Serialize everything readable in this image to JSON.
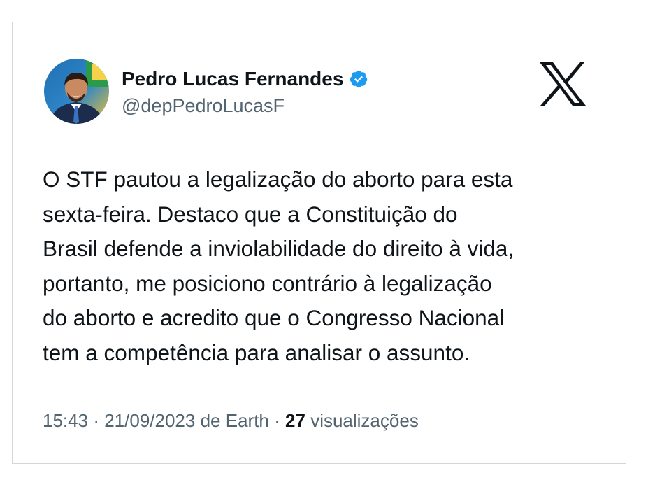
{
  "author": {
    "display_name": "Pedro Lucas Fernandes",
    "handle": "@depPedroLucasF",
    "verified": true
  },
  "tweet": {
    "lines": [
      "O STF pautou a legalização do aborto para esta",
      "sexta-feira. Destaco que a Constituição do",
      "Brasil defende a inviolabilidade do direito à vida,",
      "portanto, me posiciono contrário à legalização",
      "do aborto e acredito que o Congresso Nacional",
      "tem a competência para analisar o assunto."
    ]
  },
  "meta": {
    "time": "15:43",
    "separator": "·",
    "date": "21/09/2023",
    "source": "de Earth",
    "views_count": "27",
    "views_label": "visualizações"
  },
  "icons": {
    "logo": "x-logo-icon",
    "verified": "verified-badge-icon"
  },
  "colors": {
    "verified_blue": "#1d9bf0",
    "secondary_text": "#536471",
    "primary_text": "#0f1419"
  }
}
